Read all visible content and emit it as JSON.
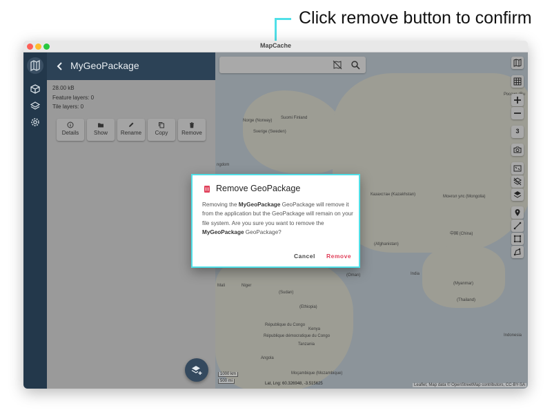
{
  "annotation": {
    "text": "Click remove button to confirm"
  },
  "window": {
    "title": "MapCache"
  },
  "drawer": {
    "title": "MyGeoPackage",
    "size": "28.00 kB",
    "feature_layers": "Feature layers: 0",
    "tile_layers": "Tile layers: 0",
    "actions": [
      {
        "label": "Details",
        "icon": "info-icon"
      },
      {
        "label": "Show",
        "icon": "folder-icon"
      },
      {
        "label": "Rename",
        "icon": "pencil-icon"
      },
      {
        "label": "Copy",
        "icon": "copy-icon"
      },
      {
        "label": "Remove",
        "icon": "trash-icon"
      }
    ]
  },
  "map": {
    "zoom_level": "3",
    "scale_km": "1000 km",
    "scale_mi": "500 mi",
    "coordinates": "Lat, Lng: 60.326948, -3.515625",
    "attribution": "Leaflet, Map data © OpenStreetMap contributors, CC-BY-SA",
    "labels": [
      "Norge (Norway)",
      "Sverige (Sweden)",
      "Suomi Finland",
      "Россия (Ru",
      "Казахстан (Kazakhstan)",
      "Монгол улс (Mongolia)",
      "中国 (China)",
      "(Afghanistan)",
      "India",
      "(Myanmar)",
      "(Thailand)",
      "Indonesia",
      "Mali",
      "Niger",
      "(Sudan)",
      "(Ethiopia)",
      "Kenya",
      "Tanzania",
      "Angola",
      "République du Congo",
      "République démocratique du Congo",
      "Moçambique (Mozambique)",
      "(Oman)",
      "ngdom"
    ]
  },
  "dialog": {
    "title": "Remove GeoPackage",
    "body_1": "Removing the ",
    "body_name_1": "MyGeoPackage",
    "body_2": " GeoPackage will remove it from the application but the GeoPackage will remain on your file system. Are you sure you want to remove the ",
    "body_name_2": "MyGeoPackage",
    "body_3": " GeoPackage?",
    "cancel_label": "Cancel",
    "remove_label": "Remove"
  },
  "colors": {
    "accent": "#4fe0e8",
    "danger": "#e0405a",
    "rail": "#23384b",
    "drawer_header": "#2c4256"
  }
}
